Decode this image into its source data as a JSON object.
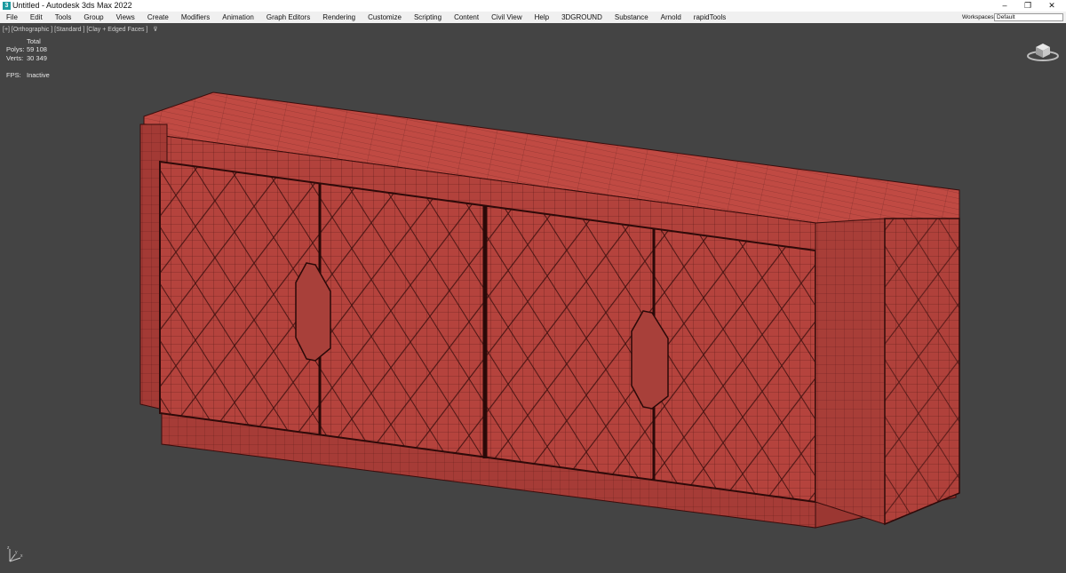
{
  "window": {
    "title": "Untitled - Autodesk 3ds Max 2022",
    "icon": "3ds-max-icon",
    "minimize": "–",
    "restore": "❐",
    "close": "✕"
  },
  "menu": {
    "items": [
      "File",
      "Edit",
      "Tools",
      "Group",
      "Views",
      "Create",
      "Modifiers",
      "Animation",
      "Graph Editors",
      "Rendering",
      "Customize",
      "Scripting",
      "Content",
      "Civil View",
      "Help",
      "3DGROUND",
      "Substance",
      "Arnold",
      "rapidTools"
    ],
    "workspace_label": "Workspaces:",
    "workspace_value": "Default"
  },
  "viewport": {
    "label": "[+] [Orthographic ] [Standard ] [Clay + Edged Faces ]",
    "filter_icon": "filter-icon",
    "stats": {
      "header": "Total",
      "polys_label": "Polys:",
      "polys_value": "59 108",
      "verts_label": "Verts:",
      "verts_value": "30 349",
      "fps_label": "FPS:",
      "fps_value": "Inactive"
    },
    "axis": {
      "x": "x",
      "y": "y",
      "z": "z"
    }
  },
  "colors": {
    "clay": "#b5433d",
    "wire": "#3d0f0d",
    "viewport_bg": "#444444"
  }
}
